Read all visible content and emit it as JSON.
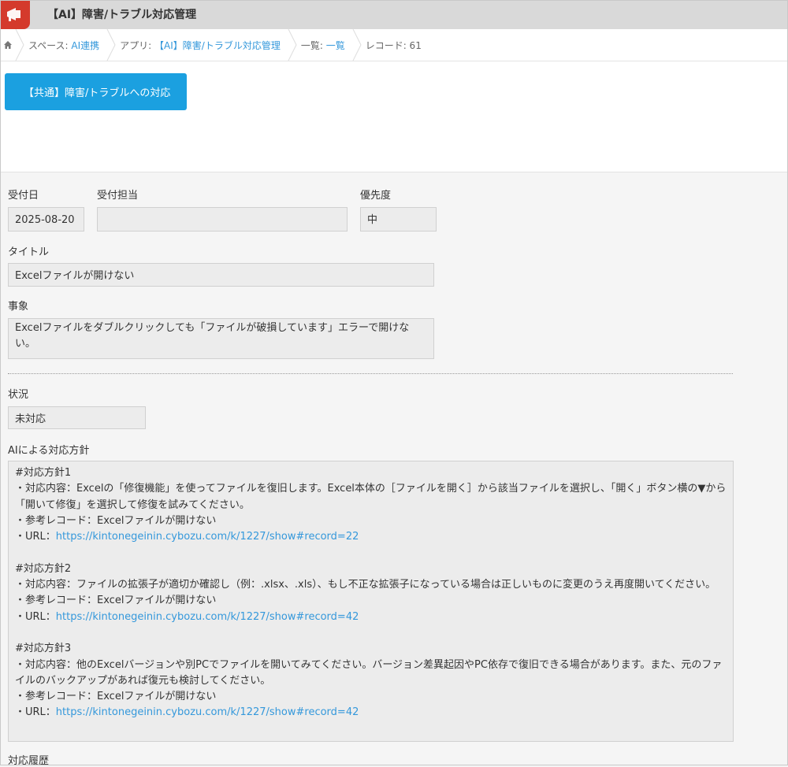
{
  "header": {
    "title": "【AI】障害/トラブル対応管理",
    "accent_color": "#d43a2c"
  },
  "breadcrumb": {
    "home_icon": "home-icon",
    "items": [
      {
        "prefix": "スペース: ",
        "link": "AI連携"
      },
      {
        "prefix": "アプリ: ",
        "link": "【AI】障害/トラブル対応管理"
      },
      {
        "prefix": "一覧: ",
        "link": "一覧"
      },
      {
        "prefix": "レコード: 61",
        "link": ""
      }
    ]
  },
  "action": {
    "button_label": "【共通】障害/トラブルへの対応",
    "button_color": "#1ba0e0"
  },
  "fields": {
    "received_date": {
      "label": "受付日",
      "value": "2025-08-20"
    },
    "assignee": {
      "label": "受付担当",
      "value": ""
    },
    "priority": {
      "label": "優先度",
      "value": "中"
    },
    "title": {
      "label": "タイトル",
      "value": "Excelファイルが開けない"
    },
    "phenomenon": {
      "label": "事象",
      "value": "Excelファイルをダブルクリックしても「ファイルが破損しています」エラーで開けない。"
    },
    "status": {
      "label": "状況",
      "value": "未対応"
    },
    "ai_policy": {
      "label": "AIによる対応方針",
      "policies": [
        {
          "heading": "#対応方針1",
          "content": "・対応内容：Excelの「修復機能」を使ってファイルを復旧します。Excel本体の［ファイルを開く］から該当ファイルを選択し、「開く」ボタン横の▼から「開いて修復」を選択して修復を試みてください。",
          "reference": "・参考レコード：Excelファイルが開けない",
          "url_prefix": "・URL：",
          "url": "https://kintonegeinin.cybozu.com/k/1227/show#record=22"
        },
        {
          "heading": "#対応方針2",
          "content": "・対応内容：ファイルの拡張子が適切か確認し（例：.xlsx、.xls）、もし不正な拡張子になっている場合は正しいものに変更のうえ再度開いてください。",
          "reference": "・参考レコード：Excelファイルが開けない",
          "url_prefix": "・URL：",
          "url": "https://kintonegeinin.cybozu.com/k/1227/show#record=42"
        },
        {
          "heading": "#対応方針3",
          "content": "・対応内容：他のExcelバージョンや別PCでファイルを開いてみてください。バージョン差異起因やPC依存で復旧できる場合があります。また、元のファイルのバックアップがあれば復元も検討してください。",
          "reference": "・参考レコード：Excelファイルが開けない",
          "url_prefix": "・URL：",
          "url": "https://kintonegeinin.cybozu.com/k/1227/show#record=42"
        }
      ]
    },
    "history": {
      "label": "対応履歴"
    }
  }
}
